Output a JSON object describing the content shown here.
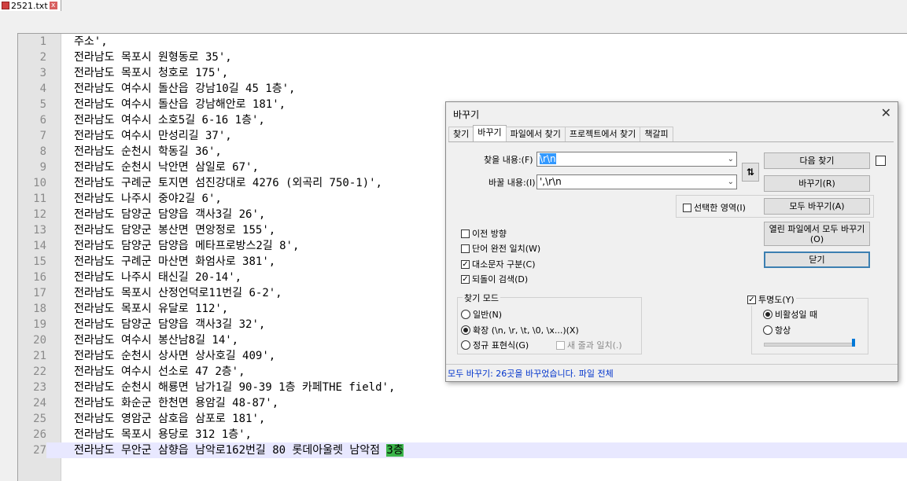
{
  "tab": {
    "filename": "2521.txt"
  },
  "editor": {
    "lines": [
      {
        "n": "1",
        "t": "주소',"
      },
      {
        "n": "2",
        "t": "전라남도 목포시 원형동로 35',"
      },
      {
        "n": "3",
        "t": "전라남도 목포시 청호로 175',"
      },
      {
        "n": "4",
        "t": "전라남도 여수시 돌산읍 강남10길 45 1층',"
      },
      {
        "n": "5",
        "t": "전라남도 여수시 돌산읍 강남해안로 181',"
      },
      {
        "n": "6",
        "t": "전라남도 여수시 소호5길 6-16 1층',"
      },
      {
        "n": "7",
        "t": "전라남도 여수시 만성리길 37',"
      },
      {
        "n": "8",
        "t": "전라남도 순천시 학동길 36',"
      },
      {
        "n": "9",
        "t": "전라남도 순천시 낙안면 삼일로 67',"
      },
      {
        "n": "10",
        "t": "전라남도 구례군 토지면 섬진강대로 4276 (외곡리 750-1)',"
      },
      {
        "n": "11",
        "t": "전라남도 나주시 중야2길 6',"
      },
      {
        "n": "12",
        "t": "전라남도 담양군 담양읍 객사3길 26',"
      },
      {
        "n": "13",
        "t": "전라남도 담양군 봉산면 면앙정로 155',"
      },
      {
        "n": "14",
        "t": "전라남도 담양군 담양읍 메타프로방스2길 8',"
      },
      {
        "n": "15",
        "t": "전라남도 구례군 마산면 화엄사로 381',"
      },
      {
        "n": "16",
        "t": "전라남도 나주시 태신길 20-14',"
      },
      {
        "n": "17",
        "t": "전라남도 목포시 산정언덕로11번길 6-2',"
      },
      {
        "n": "18",
        "t": "전라남도 목포시 유달로 112',"
      },
      {
        "n": "19",
        "t": "전라남도 담양군 담양읍 객사3길 32',"
      },
      {
        "n": "20",
        "t": "전라남도 여수시 봉산남8길 14',"
      },
      {
        "n": "21",
        "t": "전라남도 순천시 상사면 상사호길 409',"
      },
      {
        "n": "22",
        "t": "전라남도 여수시 선소로 47 2층',"
      },
      {
        "n": "23",
        "t": "전라남도 순천시 해룡면 남가1길 90-39 1층 카페THE field',"
      },
      {
        "n": "24",
        "t": "전라남도 화순군 한천면 용암길 48-87',"
      },
      {
        "n": "25",
        "t": "전라남도 영암군 삼호읍 삼포로 181',"
      },
      {
        "n": "26",
        "t": "전라남도 목포시 용당로 312 1층',"
      }
    ],
    "last_line": {
      "n": "27",
      "t": "전라남도 무안군 삼향읍 남악로162번길 80 롯데아울렛 남악점 ",
      "highlight": "3층"
    }
  },
  "dialog": {
    "title": "바꾸기",
    "close": "✕",
    "tabs": [
      "찾기",
      "바꾸기",
      "파일에서 찾기",
      "프로젝트에서 찾기",
      "책갈피"
    ],
    "find_label": "찾을 내용:(F)",
    "find_value": "\\r\\n",
    "replace_label": "바꿀 내용:(I)",
    "replace_value": "',\\r\\n",
    "swap_icon": "⇅",
    "in_selection": "선택한 영역(I)",
    "buttons": {
      "find_next": "다음 찾기",
      "replace": "바꾸기(R)",
      "replace_all": "모두 바꾸기(A)",
      "replace_all_open": "열린 파일에서 모두 바꾸기\n(O)",
      "close": "닫기"
    },
    "options": {
      "backward": "이전 방향",
      "whole_word": "단어 완전 일치(W)",
      "match_case": "대소문자 구분(C)",
      "wrap": "되돌이 검색(D)"
    },
    "mode": {
      "title": "찾기 모드",
      "normal": "일반(N)",
      "extended": "확장 (\\n, \\r, \\t, \\0, \\x...)(X)",
      "regex": "정규 표현식(G)",
      "dot_newline": "새 줄과 일치(.)"
    },
    "transparency": {
      "title": "투명도(Y)",
      "on_losing_focus": "비활성일 때",
      "always": "항상",
      "level": 0.97
    },
    "status": "모두 바꾸기: 26곳을 바꾸었습니다. 파일 전체"
  }
}
